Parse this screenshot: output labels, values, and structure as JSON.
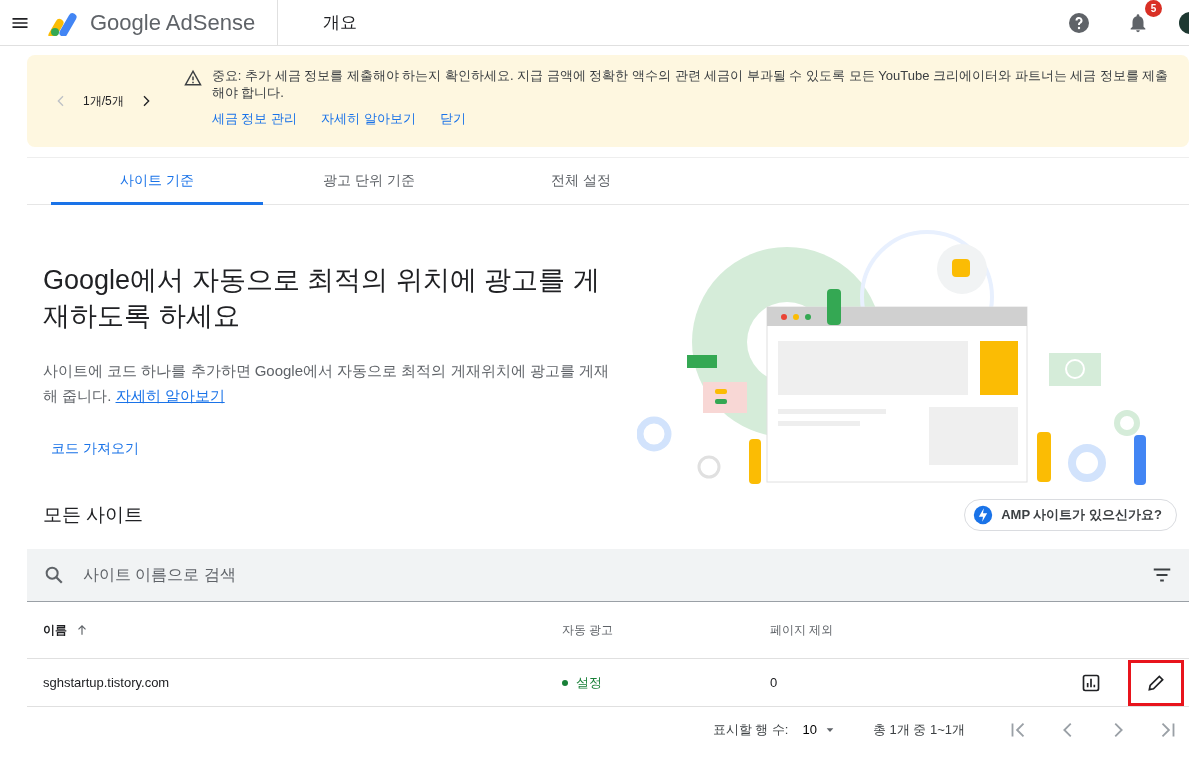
{
  "header": {
    "app_name": "Google AdSense",
    "page_title": "개요",
    "notification_count": "5"
  },
  "banner": {
    "pager": "1개/5개",
    "message": "중요: 추가 세금 정보를 제출해야 하는지 확인하세요. 지급 금액에 정확한 액수의 관련 세금이 부과될 수 있도록 모든 YouTube 크리에이터와 파트너는 세금 정보를 제출해야 합니다.",
    "links": [
      "세금 정보 관리",
      "자세히 알아보기",
      "닫기"
    ]
  },
  "tabs": [
    {
      "label": "사이트 기준",
      "selected": true
    },
    {
      "label": "광고 단위 기준",
      "selected": false
    },
    {
      "label": "전체 설정",
      "selected": false
    }
  ],
  "hero": {
    "title": "Google에서 자동으로 최적의 위치에 광고를 게재하도록 하세요",
    "description": "사이트에 코드 하나를 추가하면 Google에서 자동으로 최적의 게재위치에 광고를 게재해 줍니다.",
    "learn_more_link": "자세히 알아보기",
    "button": "코드 가져오기"
  },
  "sites": {
    "heading": "모든 사이트",
    "amp_button": "AMP 사이트가 있으신가요?",
    "search": {
      "placeholder": "사이트 이름으로 검색"
    },
    "columns": [
      "이름",
      "자동 광고",
      "페이지 제외"
    ],
    "rows": [
      {
        "name": "sghstartup.tistory.com",
        "status": "설정",
        "color": "#188038",
        "page_exclusions": "0",
        "highlighted": true
      }
    ]
  },
  "pagination": {
    "rows_label": "표시할 행 수:",
    "rows_per_page": "10",
    "range": "총 1개 중 1~1개"
  }
}
